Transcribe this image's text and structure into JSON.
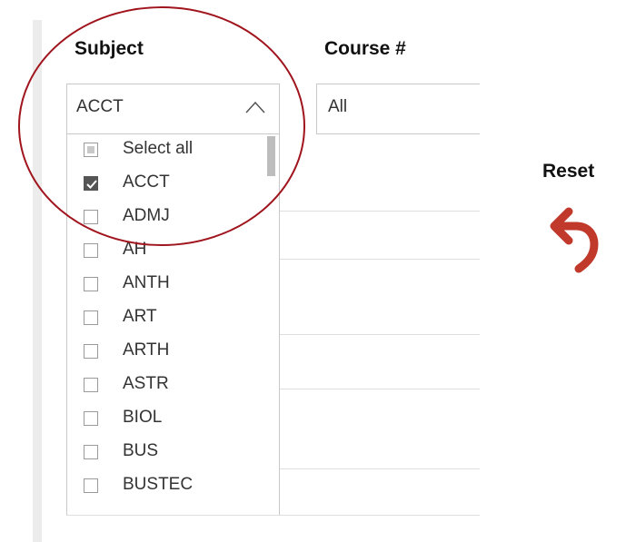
{
  "filters": {
    "subject": {
      "label": "Subject",
      "selected_value": "ACCT",
      "options": [
        {
          "label": "Select all",
          "state": "partial"
        },
        {
          "label": "ACCT",
          "state": "checked"
        },
        {
          "label": "ADMJ",
          "state": "unchecked"
        },
        {
          "label": "AH",
          "state": "unchecked"
        },
        {
          "label": "ANTH",
          "state": "unchecked"
        },
        {
          "label": "ART",
          "state": "unchecked"
        },
        {
          "label": "ARTH",
          "state": "unchecked"
        },
        {
          "label": "ASTR",
          "state": "unchecked"
        },
        {
          "label": "BIOL",
          "state": "unchecked"
        },
        {
          "label": "BUS",
          "state": "unchecked"
        },
        {
          "label": "BUSTEC",
          "state": "unchecked"
        }
      ]
    },
    "course": {
      "label": "Course #",
      "selected_value": "All"
    }
  },
  "reset": {
    "label": "Reset"
  },
  "colors": {
    "highlight": "#a0151d",
    "reset_icon": "#c0392b",
    "checked_box": "#555555"
  }
}
